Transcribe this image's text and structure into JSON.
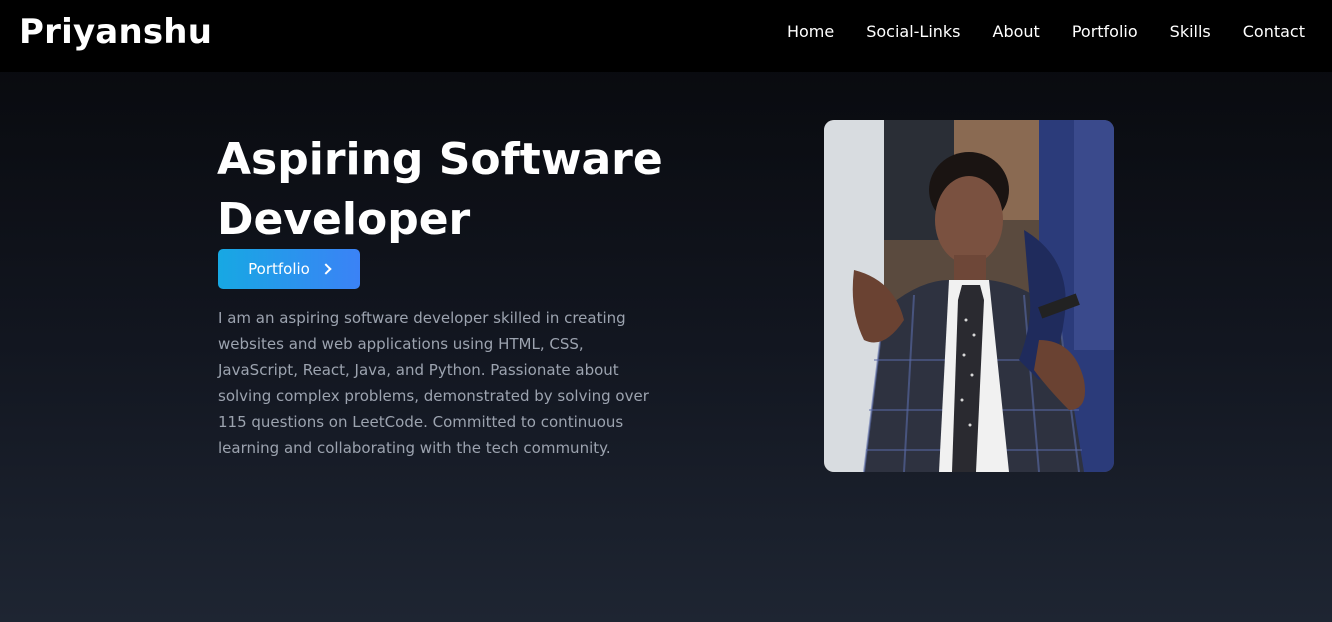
{
  "navbar": {
    "brand": "Priyanshu",
    "links": [
      {
        "label": "Home"
      },
      {
        "label": "Social-Links"
      },
      {
        "label": "About"
      },
      {
        "label": "Portfolio"
      },
      {
        "label": "Skills"
      },
      {
        "label": "Contact"
      }
    ]
  },
  "hero": {
    "title": "Aspiring Software Developer",
    "button_label": "Portfolio",
    "button_icon": "chevron-right-icon",
    "description": "I am an aspiring software developer skilled in creating websites and web applications using HTML, CSS, JavaScript, React, Java, and Python. Passionate about solving complex problems, demonstrated by solving over 115 questions on LeetCode. Committed to continuous learning and collaborating with the tech community."
  },
  "colors": {
    "navbar_bg": "#000000",
    "button_gradient_start": "#17a8e3",
    "button_gradient_end": "#3b82f6",
    "description_text": "#9ca3af"
  }
}
